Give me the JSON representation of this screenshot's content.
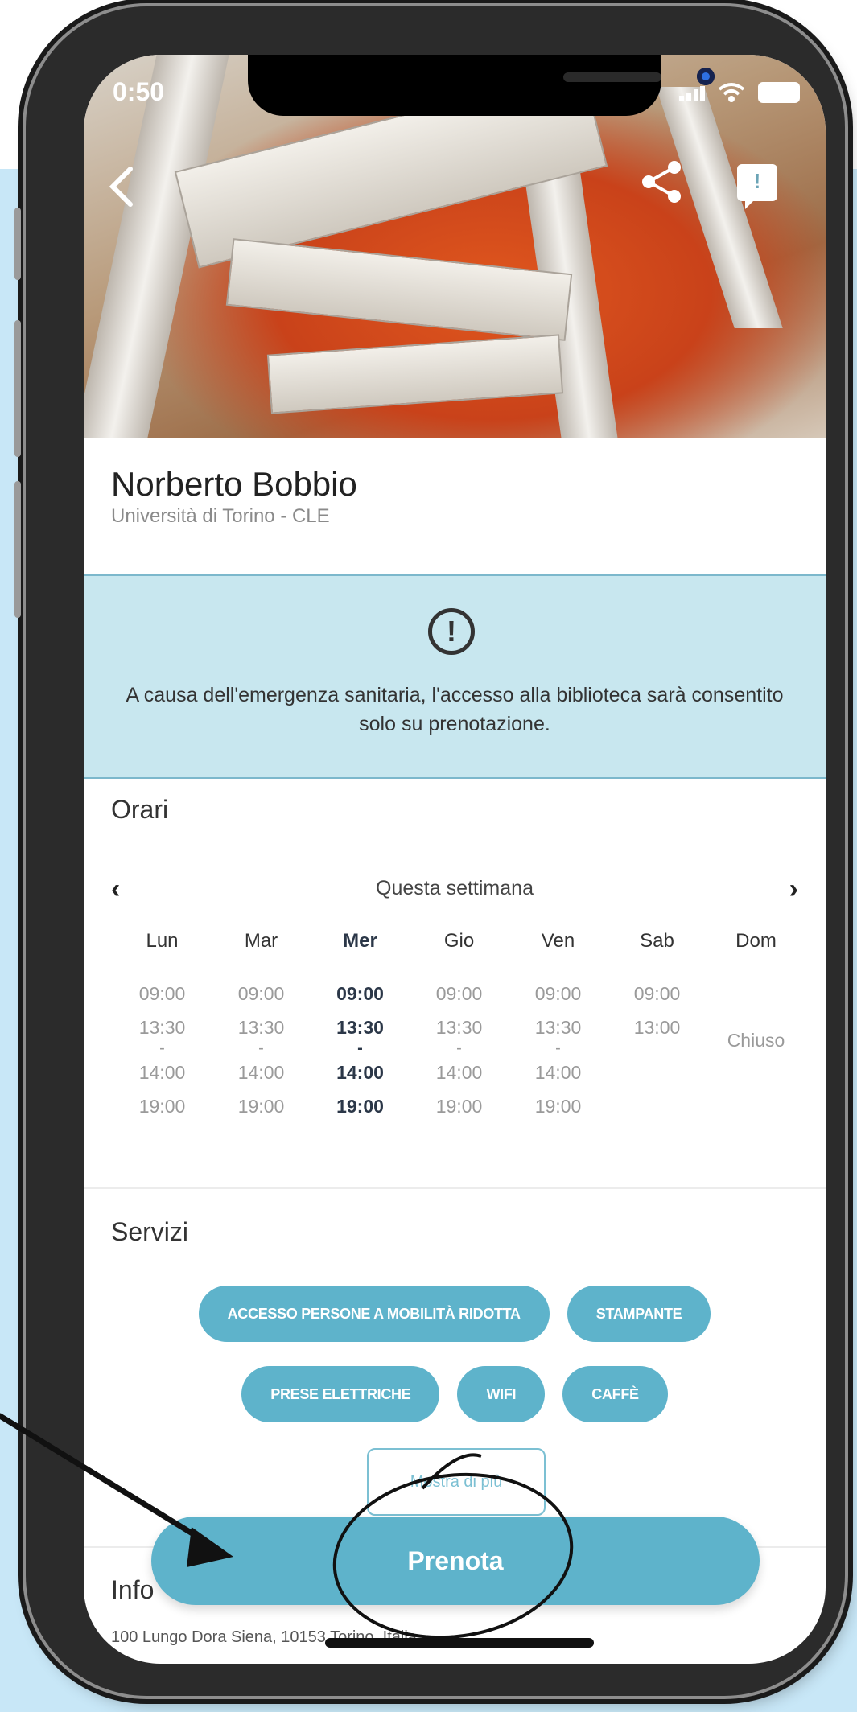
{
  "status_bar": {
    "time": "0:50"
  },
  "library": {
    "name": "Norberto Bobbio",
    "affiliation": "Università di Torino - CLE"
  },
  "notice": {
    "icon": "alert-circle-icon",
    "text": "A causa dell'emergenza sanitaria, l'accesso alla biblioteca sarà consentito solo su prenotazione."
  },
  "hours": {
    "title": "Orari",
    "week_label": "Questa settimana",
    "prev": "‹",
    "next": "›",
    "days": [
      {
        "name": "Lun",
        "open1": "09:00",
        "close1": "13:30",
        "sep": "-",
        "open2": "14:00",
        "close2": "19:00"
      },
      {
        "name": "Mar",
        "open1": "09:00",
        "close1": "13:30",
        "sep": "-",
        "open2": "14:00",
        "close2": "19:00"
      },
      {
        "name": "Mer",
        "open1": "09:00",
        "close1": "13:30",
        "sep": "-",
        "open2": "14:00",
        "close2": "19:00"
      },
      {
        "name": "Gio",
        "open1": "09:00",
        "close1": "13:30",
        "sep": "-",
        "open2": "14:00",
        "close2": "19:00"
      },
      {
        "name": "Ven",
        "open1": "09:00",
        "close1": "13:30",
        "sep": "-",
        "open2": "14:00",
        "close2": "19:00"
      },
      {
        "name": "Sab",
        "open1": "09:00",
        "close1": "13:00"
      },
      {
        "name": "Dom",
        "closed": "Chiuso"
      }
    ]
  },
  "services": {
    "title": "Servizi",
    "items": [
      "ACCESSO PERSONE A MOBILITÀ RIDOTTA",
      "STAMPANTE",
      "PRESE ELETTRICHE",
      "WIFI",
      "CAFFÈ"
    ],
    "more_label": "Mostra di più"
  },
  "info": {
    "title": "Info",
    "address": "100 Lungo Dora Siena, 10153 Torino, Italia"
  },
  "book_button": "Prenota",
  "colors": {
    "accent": "#5eb3cb",
    "notice_bg": "#c8e7ef",
    "page_bg": "#c8e7f7"
  }
}
